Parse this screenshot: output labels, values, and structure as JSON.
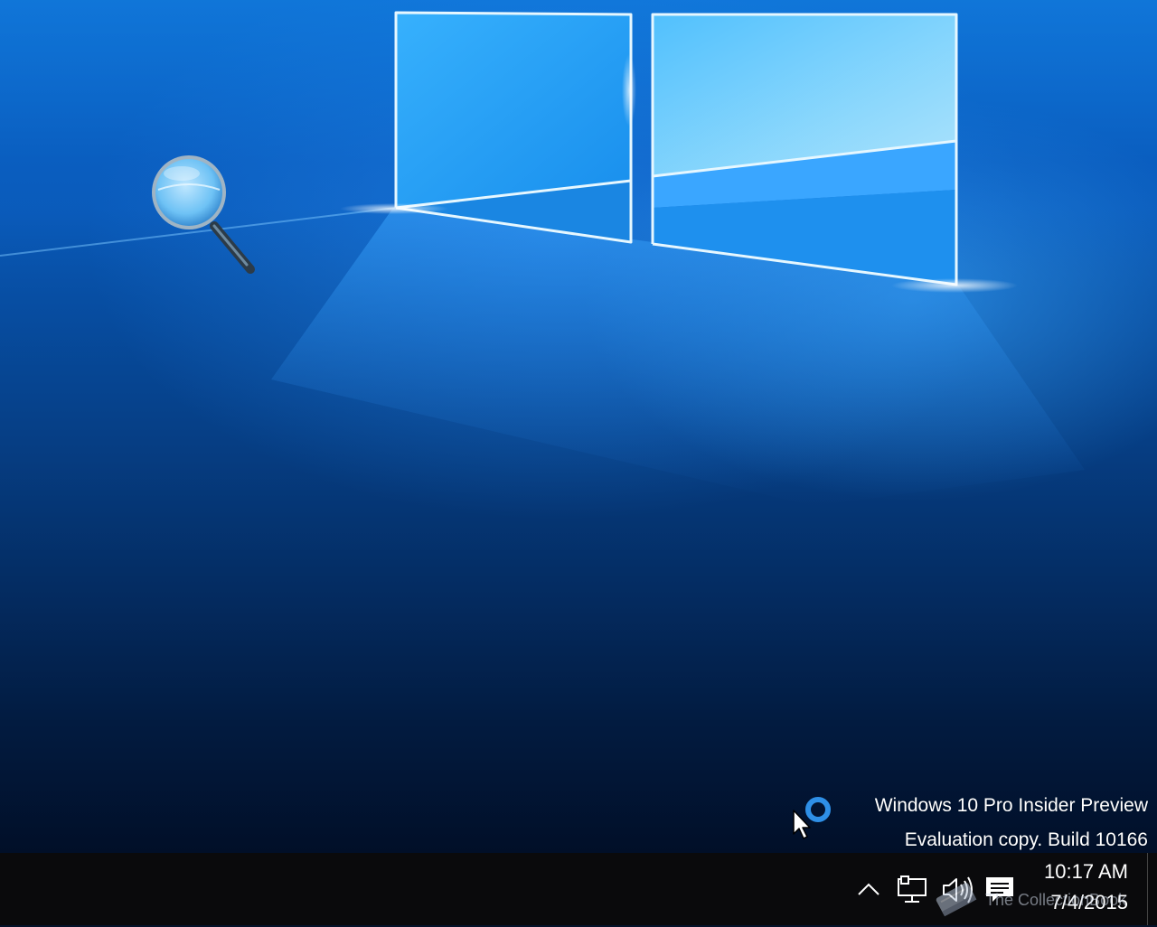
{
  "desktop": {
    "wallpaper": "windows-10-hero-light",
    "icons": [
      {
        "name": "magnifier-icon",
        "label": ""
      }
    ]
  },
  "watermark": {
    "line1": "Windows 10 Pro Insider Preview",
    "line2": "Evaluation copy. Build 10166"
  },
  "taskbar": {
    "tray_icons": [
      "chevron-up-icon",
      "network-icon",
      "volume-icon",
      "action-center-icon"
    ],
    "clock": {
      "time": "10:17 AM",
      "date": "7/4/2015"
    }
  },
  "site_mark": {
    "text": "The CollectionBook"
  },
  "colors": {
    "taskbar": "#0a0a0c",
    "accent": "#1e8fe8",
    "text": "#ffffff"
  }
}
